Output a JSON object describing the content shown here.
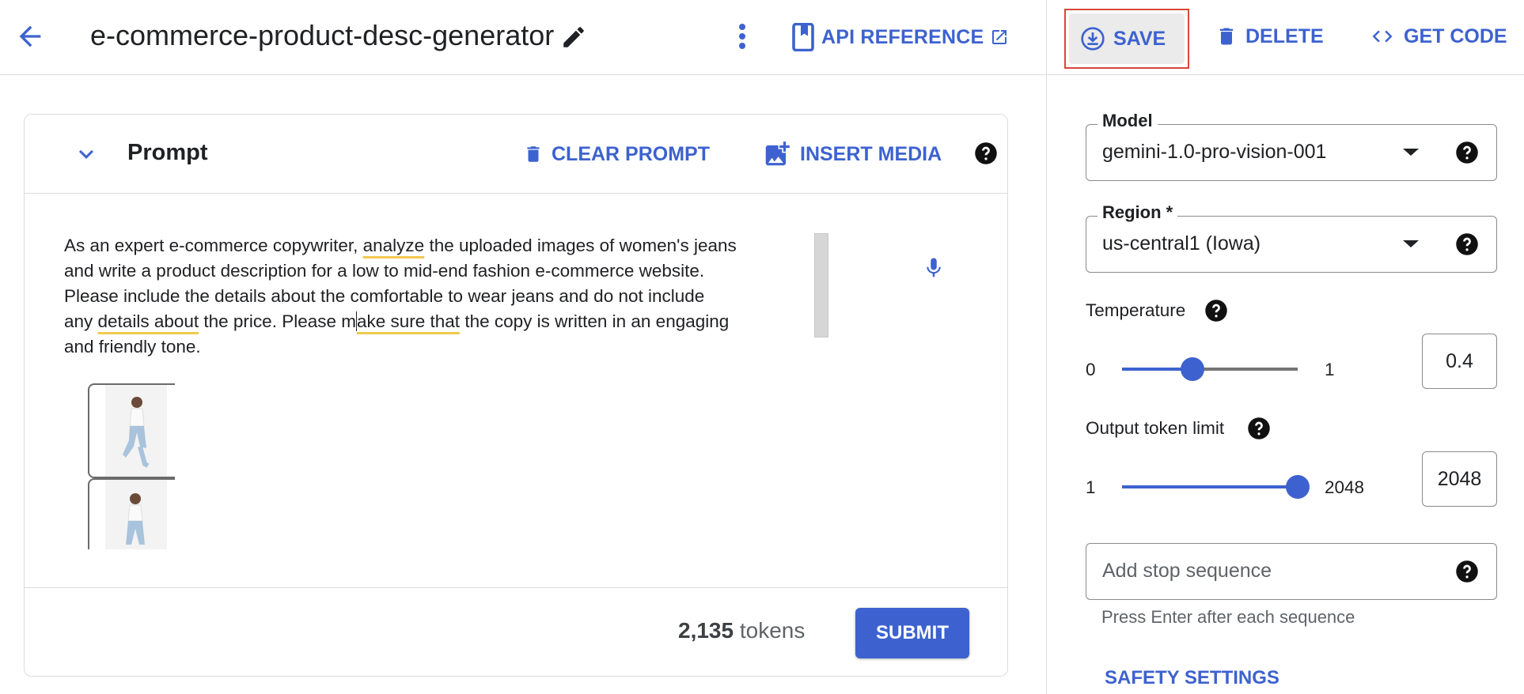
{
  "header": {
    "title": "e-commerce-product-desc-generator",
    "api_reference_label": "API REFERENCE",
    "save_label": "SAVE",
    "delete_label": "DELETE",
    "get_code_label": "GET CODE"
  },
  "prompt_card": {
    "title": "Prompt",
    "clear_label": "CLEAR PROMPT",
    "insert_media_label": "INSERT MEDIA",
    "text": {
      "p1": "As an expert e-commerce copywriter, ",
      "u1": "analyze",
      "p2": " the uploaded images of women's jeans\nand write a product description for a low to mid-end fashion e-commerce website.\nPlease include the details about the comfortable to wear jeans and do not include\nany ",
      "u2": "details about",
      "p3": " the price. Please m",
      "u3": "ake sure that",
      "p4": " the copy is written in an engaging\nand friendly tone."
    },
    "token_count": "2,135",
    "token_suffix": " tokens",
    "submit_label": "SUBMIT"
  },
  "settings": {
    "model": {
      "label": "Model",
      "value": "gemini-1.0-pro-vision-001"
    },
    "region": {
      "label": "Region *",
      "value": "us-central1 (Iowa)"
    },
    "temperature": {
      "label": "Temperature",
      "min": "0",
      "max": "1",
      "value": "0.4",
      "fraction": 0.4
    },
    "output_token_limit": {
      "label": "Output token limit",
      "min": "1",
      "max": "2048",
      "value": "2048",
      "fraction": 1.0
    },
    "stop_sequence": {
      "placeholder": "Add stop sequence",
      "hint": "Press Enter after each sequence"
    },
    "safety_settings_label": "SAFETY SETTINGS"
  },
  "colors": {
    "accent": "#3d62cf",
    "highlight_border": "#d9473b",
    "underline": "#f2c94c"
  },
  "icons": [
    "back-arrow-icon",
    "pencil-icon",
    "more-vert-icon",
    "bookmark-icon",
    "open-external-icon",
    "download-circle-icon",
    "trash-icon",
    "code-icon",
    "chevron-down-icon",
    "add-image-icon",
    "help-icon",
    "mic-icon",
    "dropdown-arrow-icon"
  ]
}
